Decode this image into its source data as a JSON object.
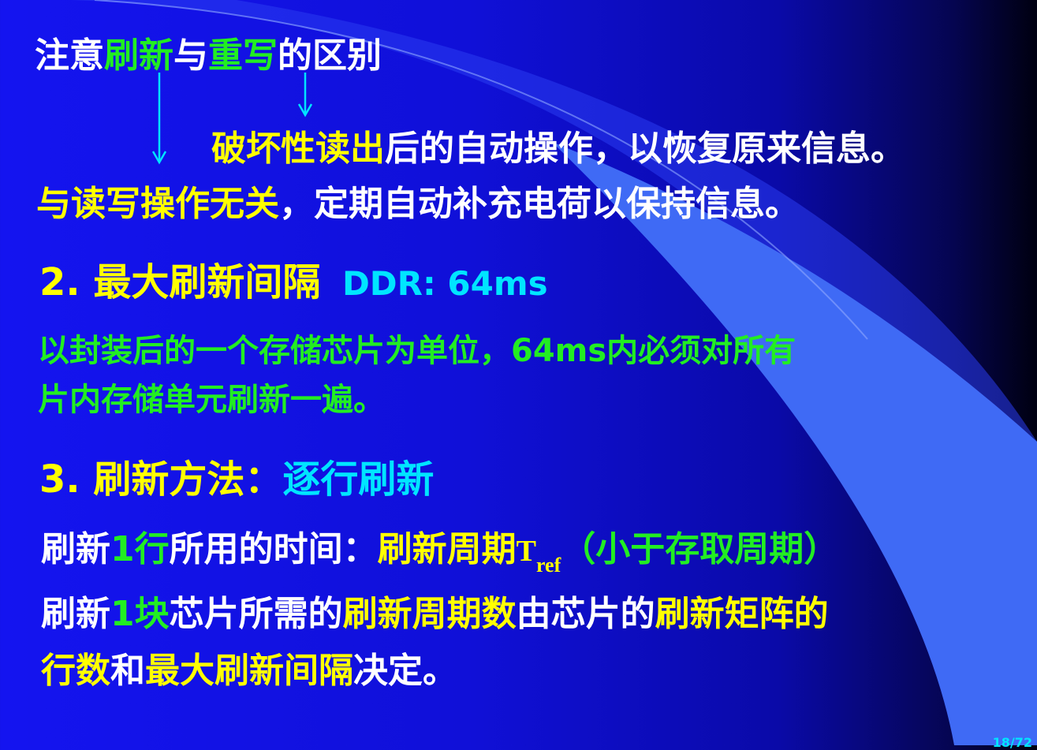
{
  "colors": {
    "white": "#ffffff",
    "yellow": "#ffff00",
    "green": "#22ee22",
    "cyan": "#00e5ff",
    "background": "#1414f0"
  },
  "header": {
    "p1": "注意",
    "p2": "刷新",
    "p3": "与",
    "p4": "重写",
    "p5": "的区别"
  },
  "rewrite_line": {
    "p1": "破坏性读出",
    "p2": "后的自动操作，以恢复原来信息。"
  },
  "refresh_line": {
    "p1": "与读写操作无关",
    "p2": "，定期自动补充电荷以保持信息。"
  },
  "section2": {
    "title": "2. 最大刷新间隔",
    "value": "DDR: 64ms",
    "line1": "以封装后的一个存储芯片为单位，64ms内必须对所有",
    "line2": "片内存储单元刷新一遍。"
  },
  "section3": {
    "title": "3. 刷新方法：",
    "method": "逐行刷新",
    "l1": {
      "p1": "刷新",
      "p2": "1行",
      "p3": "所用的时间：",
      "p4": "刷新周期",
      "t": "T",
      "sub": "ref",
      "p5": "（小于存取周期）"
    },
    "l2": {
      "p1": "刷新",
      "p2": "1块",
      "p3": "芯片所需的",
      "p4": "刷新周期数",
      "p5": "由芯片的",
      "p6": "刷新矩阵的"
    },
    "l3": {
      "p1": "行数",
      "p2": "和",
      "p3": "最大刷新间隔",
      "p4": "决定。"
    }
  },
  "page_number": "18/72"
}
